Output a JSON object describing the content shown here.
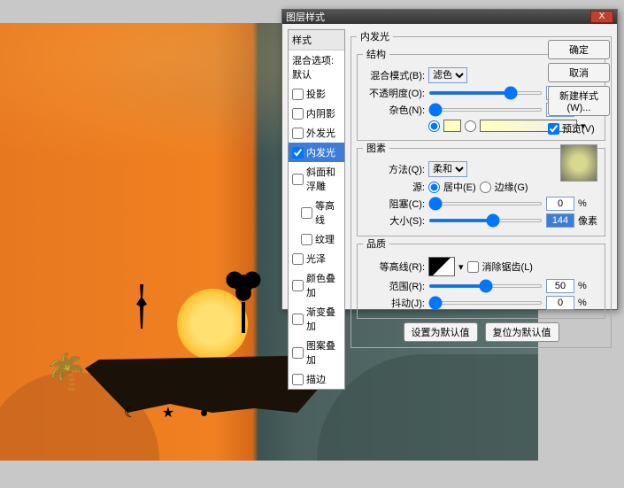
{
  "dialog": {
    "title": "图层样式",
    "close": "X",
    "styles_header": "样式",
    "styles_blend_default": "混合选项:默认",
    "style_items": [
      {
        "label": "投影",
        "checked": false,
        "selected": false
      },
      {
        "label": "内阴影",
        "checked": false,
        "selected": false
      },
      {
        "label": "外发光",
        "checked": false,
        "selected": false
      },
      {
        "label": "内发光",
        "checked": true,
        "selected": true
      },
      {
        "label": "斜面和浮雕",
        "checked": false,
        "selected": false
      },
      {
        "label": "等高线",
        "checked": false,
        "selected": false,
        "indent": true
      },
      {
        "label": "纹理",
        "checked": false,
        "selected": false,
        "indent": true
      },
      {
        "label": "光泽",
        "checked": false,
        "selected": false
      },
      {
        "label": "颜色叠加",
        "checked": false,
        "selected": false
      },
      {
        "label": "渐变叠加",
        "checked": false,
        "selected": false
      },
      {
        "label": "图案叠加",
        "checked": false,
        "selected": false
      },
      {
        "label": "描边",
        "checked": false,
        "selected": false
      }
    ],
    "panel_title": "内发光",
    "groups": {
      "structure": {
        "legend": "结构",
        "blend_mode_label": "混合模式(B):",
        "blend_mode_value": "滤色",
        "opacity_label": "不透明度(O):",
        "opacity_value": "75",
        "opacity_unit": "%",
        "noise_label": "杂色(N):",
        "noise_value": "0",
        "noise_unit": "%",
        "color_solid": "#ffffbe"
      },
      "elements": {
        "legend": "图素",
        "technique_label": "方法(Q):",
        "technique_value": "柔和",
        "source_label": "源:",
        "source_center": "居中(E)",
        "source_edge": "边缘(G)",
        "choke_label": "阻塞(C):",
        "choke_value": "0",
        "choke_unit": "%",
        "size_label": "大小(S):",
        "size_value": "144",
        "size_unit": "像素"
      },
      "quality": {
        "legend": "品质",
        "contour_label": "等高线(R):",
        "antialias_label": "消除锯齿(L)",
        "range_label": "范围(R):",
        "range_value": "50",
        "range_unit": "%",
        "jitter_label": "抖动(J):",
        "jitter_value": "0",
        "jitter_unit": "%"
      }
    },
    "buttons": {
      "make_default": "设置为默认值",
      "reset_default": "复位为默认值",
      "ok": "确定",
      "cancel": "取消",
      "new_style": "新建样式(W)...",
      "preview": "预览(V)"
    }
  }
}
